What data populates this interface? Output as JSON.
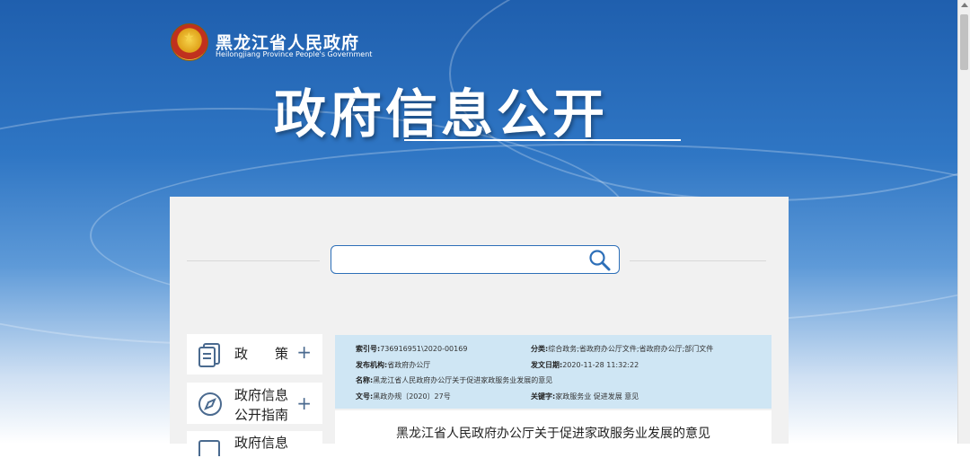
{
  "header": {
    "gov_name": "黑龙江省人民政府",
    "gov_name_en": "Heilongjiang Province People's Government",
    "page_title": "政府信息公开"
  },
  "search": {
    "value": "",
    "placeholder": ""
  },
  "nav": {
    "items": [
      {
        "label": "政　　策",
        "icon": "document-stack-icon"
      },
      {
        "label": "政府信息\n公开指南",
        "icon": "compass-icon"
      },
      {
        "label": "政府信息",
        "icon": "list-icon"
      }
    ],
    "plus": "+"
  },
  "meta": {
    "index_label": "索引号:",
    "index_value": "736916951\\2020-00169",
    "category_label": "分类:",
    "category_value": "综合政务;省政府办公厅文件;省政府办公厅;部门文件",
    "publisher_label": "发布机构:",
    "publisher_value": "省政府办公厅",
    "date_label": "发文日期:",
    "date_value": "2020-11-28 11:32:22",
    "name_label": "名称:",
    "name_value": "黑龙江省人民政府办公厅关于促进家政服务业发展的意见",
    "docno_label": "文号:",
    "docno_value": "黑政办规〔2020〕27号",
    "keywords_label": "关键字:",
    "keywords_value": "家政服务业 促进发展 意见"
  },
  "document": {
    "title": "黑龙江省人民政府办公厅关于促进家政服务业发展的意见"
  },
  "colors": {
    "accent": "#2d6fb8",
    "meta_bg": "#cfe6f4",
    "panel_bg": "#f1f1f1"
  }
}
